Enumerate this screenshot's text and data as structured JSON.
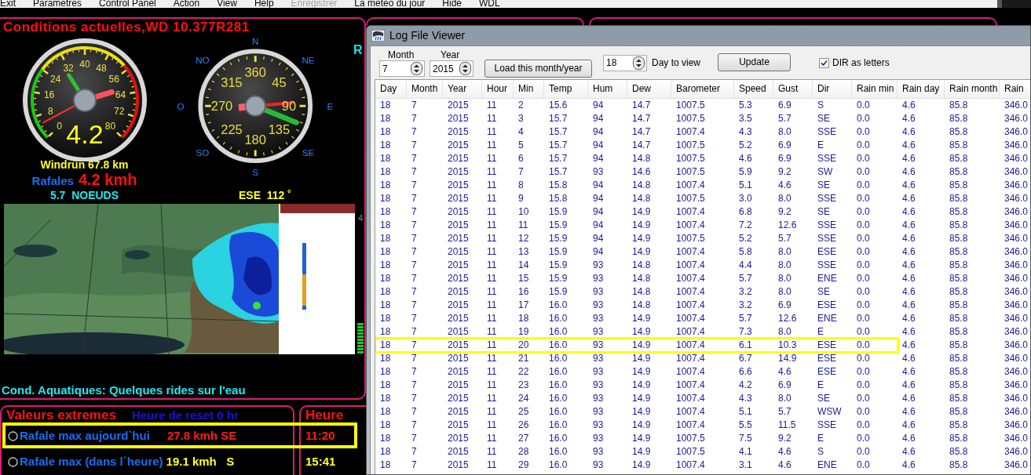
{
  "menu_bar": {
    "items": [
      {
        "label": "Exit",
        "disabled": false
      },
      {
        "label": "Parametres",
        "disabled": false
      },
      {
        "label": "Control Panel",
        "disabled": false
      },
      {
        "label": "Action",
        "disabled": false
      },
      {
        "label": "View",
        "disabled": false
      },
      {
        "label": "Help",
        "disabled": false
      },
      {
        "label": "Enregistrer",
        "disabled": true
      },
      {
        "label": "La meteo du jour",
        "disabled": false
      },
      {
        "label": "Hide",
        "disabled": false
      },
      {
        "label": "WDL",
        "disabled": false
      }
    ]
  },
  "conditions_panel": {
    "title": "Conditions actuelles,WD 10.377R281",
    "wind_gauge": {
      "ticks": [
        "40",
        "32",
        "48",
        "24",
        "56",
        "16",
        "64",
        "8",
        "72",
        "0",
        "80"
      ],
      "reading": "4.2"
    },
    "windrun": "Windrun 67.8 km",
    "gusts_label": "Rafales",
    "gusts_value": "4.2 kmh",
    "knots": "5.7  NOEUDS",
    "compass": {
      "cardinals": [
        "N",
        "NO",
        "NE",
        "O",
        "E",
        "SO",
        "SE",
        "S"
      ],
      "ticks": [
        "360",
        "315",
        "45",
        "270",
        "90",
        "225",
        "135",
        "180"
      ]
    },
    "direction": "ESE  112 ˚",
    "side_label": "R",
    "meter_label": "4",
    "aquatic_conditions": "Cond. Aquatiques: Quelques rides sur l'eau"
  },
  "extremes_panel": {
    "title": "Valeurs extremes",
    "reset": "Heure de reset 0 hr",
    "time_heading": "Heure",
    "rows": [
      {
        "label": "Rafale max aujourd`hui",
        "value": "27.8 kmh SE",
        "time": "11:20",
        "color": "#ff1a1a",
        "highlighted": true,
        "selected": false
      },
      {
        "label": "Rafale max (dans l`heure)",
        "value": "19.1 kmh   S",
        "time": "15:41",
        "color": "#ffff20",
        "highlighted": false,
        "selected": false
      }
    ]
  },
  "log_viewer": {
    "title": "Log File Viewer",
    "month_label": "Month",
    "month": "7",
    "year_label": "Year",
    "year": "2015",
    "load_button": "Load this month/year",
    "day": "18",
    "day_label": "Day to view",
    "update_button": "Update",
    "dir_letters": {
      "label": "DIR as letters",
      "checked": true
    },
    "columns": [
      "Day",
      "Month",
      "Year",
      "Hour",
      "Min",
      "Temp",
      "Hum",
      "Dew",
      "Barometer",
      "Speed",
      "Gust",
      "Dir",
      "Rain min",
      "Rain day",
      "Rain month",
      "Rain"
    ],
    "rows": [
      {
        "cells": [
          "18",
          "7",
          "2015",
          "11",
          "2",
          "15.6",
          "94",
          "14.7",
          "1007.5",
          "5.3",
          "6.9",
          "S",
          "0.0",
          "4.6",
          "85.8",
          "346.0"
        ],
        "highlighted": false
      },
      {
        "cells": [
          "18",
          "7",
          "2015",
          "11",
          "3",
          "15.7",
          "94",
          "14.7",
          "1007.5",
          "3.5",
          "5.7",
          "SE",
          "0.0",
          "4.6",
          "85.8",
          "346.0"
        ],
        "highlighted": false
      },
      {
        "cells": [
          "18",
          "7",
          "2015",
          "11",
          "4",
          "15.7",
          "94",
          "14.7",
          "1007.4",
          "4.3",
          "8.0",
          "SSE",
          "0.0",
          "4.6",
          "85.8",
          "346.0"
        ],
        "highlighted": false
      },
      {
        "cells": [
          "18",
          "7",
          "2015",
          "11",
          "5",
          "15.7",
          "94",
          "14.7",
          "1007.5",
          "5.2",
          "6.9",
          "E",
          "0.0",
          "4.6",
          "85.8",
          "346.0"
        ],
        "highlighted": false
      },
      {
        "cells": [
          "18",
          "7",
          "2015",
          "11",
          "6",
          "15.7",
          "94",
          "14.8",
          "1007.5",
          "4.6",
          "6.9",
          "SSE",
          "0.0",
          "4.6",
          "85.8",
          "346.0"
        ],
        "highlighted": false
      },
      {
        "cells": [
          "18",
          "7",
          "2015",
          "11",
          "7",
          "15.7",
          "93",
          "14.6",
          "1007.5",
          "5.9",
          "9.2",
          "SW",
          "0.0",
          "4.6",
          "85.8",
          "346.0"
        ],
        "highlighted": false
      },
      {
        "cells": [
          "18",
          "7",
          "2015",
          "11",
          "8",
          "15.8",
          "94",
          "14.8",
          "1007.4",
          "5.1",
          "4.6",
          "SE",
          "0.0",
          "4.6",
          "85.8",
          "346.0"
        ],
        "highlighted": false
      },
      {
        "cells": [
          "18",
          "7",
          "2015",
          "11",
          "9",
          "15.8",
          "94",
          "14.8",
          "1007.5",
          "3.0",
          "8.0",
          "SSE",
          "0.0",
          "4.6",
          "85.8",
          "346.0"
        ],
        "highlighted": false
      },
      {
        "cells": [
          "18",
          "7",
          "2015",
          "11",
          "10",
          "15.9",
          "94",
          "14.9",
          "1007.4",
          "6.8",
          "9.2",
          "SE",
          "0.0",
          "4.6",
          "85.8",
          "346.0"
        ],
        "highlighted": false
      },
      {
        "cells": [
          "18",
          "7",
          "2015",
          "11",
          "11",
          "15.9",
          "94",
          "14.9",
          "1007.4",
          "7.2",
          "12.6",
          "SSE",
          "0.0",
          "4.6",
          "85.8",
          "346.0"
        ],
        "highlighted": false
      },
      {
        "cells": [
          "18",
          "7",
          "2015",
          "11",
          "12",
          "15.9",
          "94",
          "14.9",
          "1007.5",
          "5.2",
          "5.7",
          "SSE",
          "0.0",
          "4.6",
          "85.8",
          "346.0"
        ],
        "highlighted": false
      },
      {
        "cells": [
          "18",
          "7",
          "2015",
          "11",
          "13",
          "15.9",
          "94",
          "14.9",
          "1007.4",
          "5.8",
          "8.0",
          "ESE",
          "0.0",
          "4.6",
          "85.8",
          "346.0"
        ],
        "highlighted": false
      },
      {
        "cells": [
          "18",
          "7",
          "2015",
          "11",
          "14",
          "15.9",
          "93",
          "14.8",
          "1007.4",
          "4.4",
          "8.0",
          "SSE",
          "0.0",
          "4.6",
          "85.8",
          "346.0"
        ],
        "highlighted": false
      },
      {
        "cells": [
          "18",
          "7",
          "2015",
          "11",
          "15",
          "15.9",
          "93",
          "14.8",
          "1007.4",
          "5.7",
          "8.0",
          "ENE",
          "0.0",
          "4.6",
          "85.8",
          "346.0"
        ],
        "highlighted": false
      },
      {
        "cells": [
          "18",
          "7",
          "2015",
          "11",
          "16",
          "15.9",
          "93",
          "14.8",
          "1007.4",
          "3.2",
          "8.0",
          "SE",
          "0.0",
          "4.6",
          "85.8",
          "346.0"
        ],
        "highlighted": false
      },
      {
        "cells": [
          "18",
          "7",
          "2015",
          "11",
          "17",
          "16.0",
          "93",
          "14.8",
          "1007.4",
          "3.2",
          "6.9",
          "ESE",
          "0.0",
          "4.6",
          "85.8",
          "346.0"
        ],
        "highlighted": false
      },
      {
        "cells": [
          "18",
          "7",
          "2015",
          "11",
          "18",
          "16.0",
          "93",
          "14.9",
          "1007.4",
          "5.7",
          "12.6",
          "ENE",
          "0.0",
          "4.6",
          "85.8",
          "346.0"
        ],
        "highlighted": false
      },
      {
        "cells": [
          "18",
          "7",
          "2015",
          "11",
          "19",
          "16.0",
          "93",
          "14.9",
          "1007.4",
          "7.3",
          "8.0",
          "E",
          "0.0",
          "4.6",
          "85.8",
          "346.0"
        ],
        "highlighted": false
      },
      {
        "cells": [
          "18",
          "7",
          "2015",
          "11",
          "20",
          "16.0",
          "93",
          "14.9",
          "1007.4",
          "6.1",
          "10.3",
          "ESE",
          "0.0",
          "4.6",
          "85.8",
          "346.0"
        ],
        "highlighted": true
      },
      {
        "cells": [
          "18",
          "7",
          "2015",
          "11",
          "21",
          "16.0",
          "93",
          "14.9",
          "1007.4",
          "6.7",
          "14.9",
          "ESE",
          "0.0",
          "4.6",
          "85.8",
          "346.0"
        ],
        "highlighted": false
      },
      {
        "cells": [
          "18",
          "7",
          "2015",
          "11",
          "22",
          "16.0",
          "93",
          "14.9",
          "1007.4",
          "6.6",
          "4.6",
          "ESE",
          "0.0",
          "4.6",
          "85.8",
          "346.0"
        ],
        "highlighted": false
      },
      {
        "cells": [
          "18",
          "7",
          "2015",
          "11",
          "23",
          "16.0",
          "93",
          "14.9",
          "1007.4",
          "4.2",
          "6.9",
          "E",
          "0.0",
          "4.6",
          "85.8",
          "346.0"
        ],
        "highlighted": false
      },
      {
        "cells": [
          "18",
          "7",
          "2015",
          "11",
          "24",
          "16.0",
          "93",
          "14.9",
          "1007.4",
          "4.3",
          "8.0",
          "SE",
          "0.0",
          "4.6",
          "85.8",
          "346.0"
        ],
        "highlighted": false
      },
      {
        "cells": [
          "18",
          "7",
          "2015",
          "11",
          "25",
          "16.0",
          "93",
          "14.9",
          "1007.4",
          "5.1",
          "5.7",
          "WSW",
          "0.0",
          "4.6",
          "85.8",
          "346.0"
        ],
        "highlighted": false
      },
      {
        "cells": [
          "18",
          "7",
          "2015",
          "11",
          "26",
          "16.0",
          "93",
          "14.9",
          "1007.4",
          "5.5",
          "11.5",
          "SSE",
          "0.0",
          "4.6",
          "85.8",
          "346.0"
        ],
        "highlighted": false
      },
      {
        "cells": [
          "18",
          "7",
          "2015",
          "11",
          "27",
          "16.0",
          "93",
          "14.9",
          "1007.5",
          "7.5",
          "9.2",
          "E",
          "0.0",
          "4.6",
          "85.8",
          "346.0"
        ],
        "highlighted": false
      },
      {
        "cells": [
          "18",
          "7",
          "2015",
          "11",
          "28",
          "16.0",
          "93",
          "14.9",
          "1007.5",
          "4.1",
          "4.6",
          "S",
          "0.0",
          "4.6",
          "85.8",
          "346.0"
        ],
        "highlighted": false
      },
      {
        "cells": [
          "18",
          "7",
          "2015",
          "11",
          "29",
          "16.0",
          "93",
          "14.9",
          "1007.4",
          "3.1",
          "4.6",
          "ENE",
          "0.0",
          "4.6",
          "85.8",
          "346.0"
        ],
        "highlighted": false
      }
    ]
  }
}
